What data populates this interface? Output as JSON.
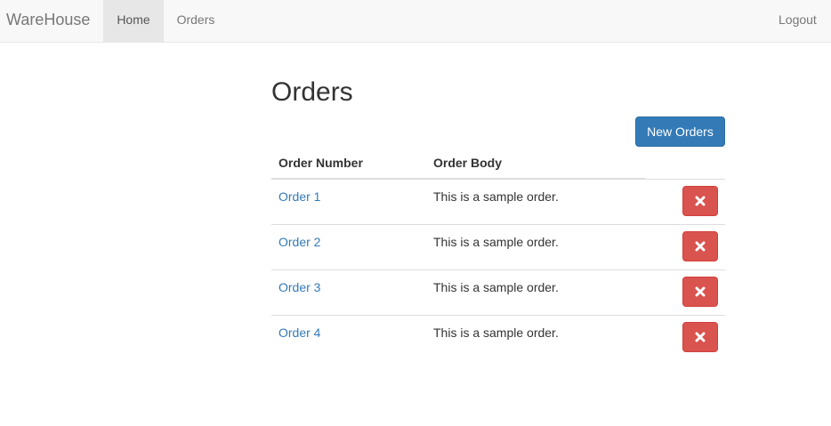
{
  "navbar": {
    "brand": "WareHouse",
    "items": [
      {
        "label": "Home",
        "active": true
      },
      {
        "label": "Orders",
        "active": false
      }
    ],
    "logout": "Logout"
  },
  "page": {
    "title": "Orders",
    "new_button": "New Orders"
  },
  "table": {
    "headers": [
      "Order Number",
      "Order Body"
    ],
    "rows": [
      {
        "number": "Order 1",
        "body": "This is a sample order.",
        "action_icon": "remove-icon"
      },
      {
        "number": "Order 2",
        "body": "This is a sample order.",
        "action_icon": "remove-icon"
      },
      {
        "number": "Order 3",
        "body": "This is a sample order.",
        "action_icon": "remove-icon"
      },
      {
        "number": "Order 4",
        "body": "This is a sample order.",
        "action_icon": "remove-icon"
      }
    ]
  },
  "colors": {
    "primary": "#337ab7",
    "danger": "#d9534f",
    "navbar_bg": "#f8f8f8",
    "link": "#337ab7"
  }
}
